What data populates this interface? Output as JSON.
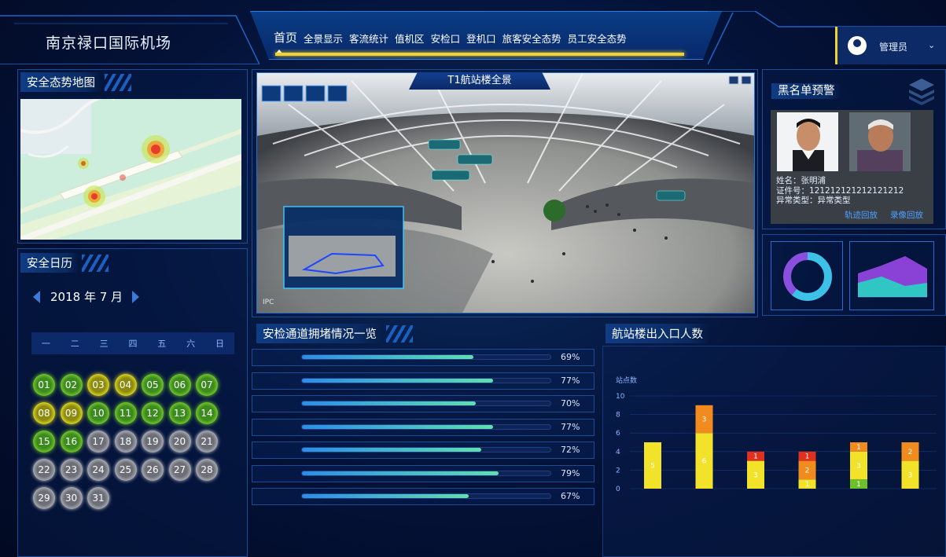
{
  "header": {
    "brand": "南京禄口国际机场",
    "nav": [
      "首页",
      "全景显示",
      "客流统计",
      "值机区",
      "安检口",
      "登机口",
      "旅客安全态势",
      "员工安全态势"
    ],
    "user": "管理员"
  },
  "map_panel": {
    "title": "安全态势地图"
  },
  "calendar": {
    "title": "安全日历",
    "month": "2018 年 7 月",
    "weekdays": [
      "一",
      "二",
      "三",
      "四",
      "五",
      "六",
      "日"
    ],
    "days": [
      {
        "d": "01",
        "s": "green"
      },
      {
        "d": "02",
        "s": "green"
      },
      {
        "d": "03",
        "s": "yellow"
      },
      {
        "d": "04",
        "s": "yellow"
      },
      {
        "d": "05",
        "s": "green"
      },
      {
        "d": "06",
        "s": "green"
      },
      {
        "d": "07",
        "s": "green"
      },
      {
        "d": "08",
        "s": "yellow"
      },
      {
        "d": "09",
        "s": "yellow"
      },
      {
        "d": "10",
        "s": "green"
      },
      {
        "d": "11",
        "s": "green"
      },
      {
        "d": "12",
        "s": "green"
      },
      {
        "d": "13",
        "s": "green"
      },
      {
        "d": "14",
        "s": "green"
      },
      {
        "d": "15",
        "s": "green"
      },
      {
        "d": "16",
        "s": "green"
      },
      {
        "d": "17",
        "s": "gray"
      },
      {
        "d": "18",
        "s": "gray"
      },
      {
        "d": "19",
        "s": "gray"
      },
      {
        "d": "20",
        "s": "gray"
      },
      {
        "d": "21",
        "s": "gray"
      },
      {
        "d": "22",
        "s": "gray"
      },
      {
        "d": "23",
        "s": "gray"
      },
      {
        "d": "24",
        "s": "gray"
      },
      {
        "d": "25",
        "s": "gray"
      },
      {
        "d": "26",
        "s": "gray"
      },
      {
        "d": "27",
        "s": "gray"
      },
      {
        "d": "28",
        "s": "gray"
      },
      {
        "d": "29",
        "s": "gray"
      },
      {
        "d": "30",
        "s": "gray"
      },
      {
        "d": "31",
        "s": "gray"
      }
    ]
  },
  "panorama": {
    "title": "T1航站楼全景",
    "cam_label": "IPC"
  },
  "blacklist": {
    "title": "黑名单预警",
    "name_line": "姓名：张明浦",
    "id_line": "证件号：121212121212121212",
    "type_line": "异常类型：异常类型",
    "link_track": "轨迹回放",
    "link_video": "录像回放"
  },
  "congestion": {
    "title": "安检通道拥堵情况一览",
    "lanes": [
      {
        "pct": "69%",
        "v": 0.69
      },
      {
        "pct": "77%",
        "v": 0.77
      },
      {
        "pct": "70%",
        "v": 0.7
      },
      {
        "pct": "77%",
        "v": 0.77
      },
      {
        "pct": "72%",
        "v": 0.72
      },
      {
        "pct": "79%",
        "v": 0.79
      },
      {
        "pct": "67%",
        "v": 0.67
      }
    ]
  },
  "chart_data": {
    "type": "bar",
    "title": "航站楼出入口人数",
    "ylabel": "站点数",
    "ylim": [
      0,
      10
    ],
    "yticks": [
      "10",
      "8",
      "6",
      "4",
      "2",
      "0"
    ],
    "series": [
      {
        "values": [
          0,
          0,
          0,
          0,
          1,
          0
        ],
        "color": "#6cc12a"
      },
      {
        "values": [
          5,
          6,
          3,
          1,
          3,
          3
        ],
        "color": "#f2e32a"
      },
      {
        "values": [
          0,
          3,
          0,
          2,
          1,
          2
        ],
        "color": "#f28b1e"
      },
      {
        "values": [
          0,
          0,
          1,
          1,
          0,
          0
        ],
        "color": "#e0301e"
      }
    ]
  }
}
